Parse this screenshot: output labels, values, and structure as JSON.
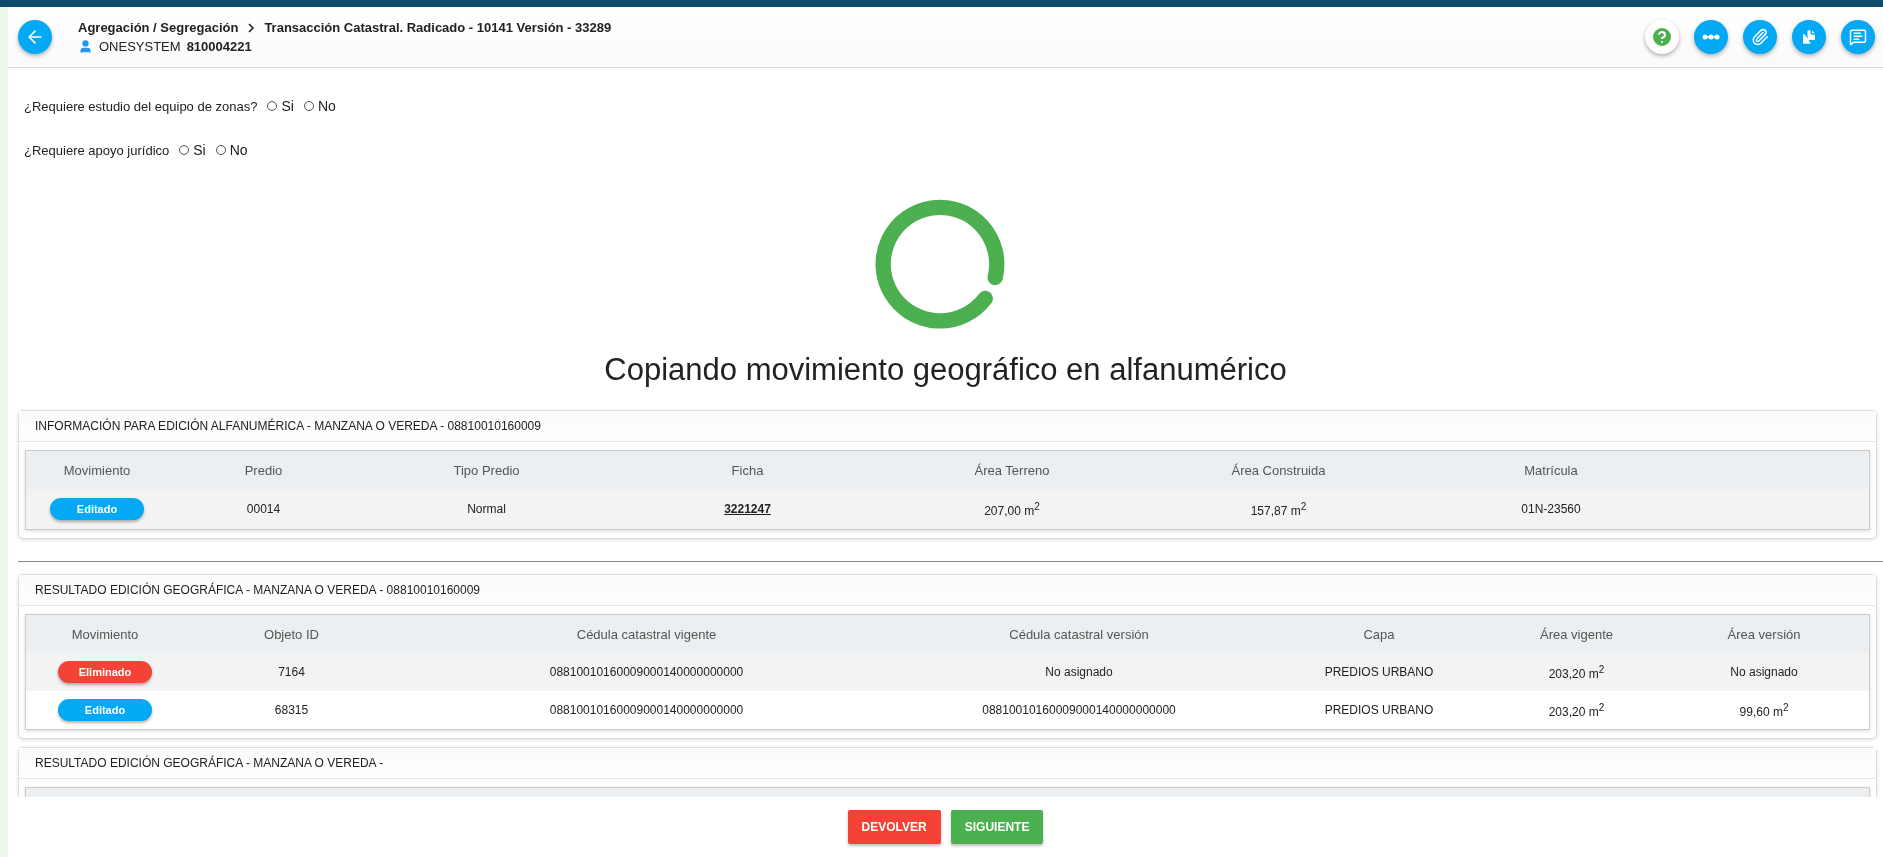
{
  "header": {
    "breadcrumb": [
      "Agregación / Segregación",
      "Transacción Catastral. Radicado - 10141 Versión - 33289"
    ],
    "user": {
      "name": "ONESYSTEM",
      "id": "810004221"
    }
  },
  "questions": [
    {
      "label": "¿Requiere estudio del equipo de zonas?",
      "options": [
        {
          "label": "Si",
          "selected": false
        },
        {
          "label": "No",
          "selected": false
        }
      ]
    },
    {
      "label": "¿Requiere apoyo jurídico",
      "options": [
        {
          "label": "Si",
          "selected": false
        },
        {
          "label": "No",
          "selected": false
        }
      ]
    }
  ],
  "loading": {
    "message": "Copiando movimiento geográfico en alfanumérico"
  },
  "alfanumeric": {
    "title": "INFORMACIÓN PARA EDICIÓN ALFANUMÉRICA - MANZANA O VEREDA - 08810010160009",
    "columns": [
      "Movimiento",
      "Predio",
      "Tipo Predio",
      "Ficha",
      "Área Terreno",
      "Área Construida",
      "Matrícula"
    ],
    "rows": [
      {
        "movimiento": {
          "label": "Editado",
          "color": "#03a9f4"
        },
        "predio": "00014",
        "tipo_predio": "Normal",
        "ficha": "3221247",
        "area_terreno": "207,00 m$^{2}$",
        "area_construida": "157,87 m$^{2}$",
        "matricula": "01N-23560"
      }
    ]
  },
  "geographic": [
    {
      "title": "RESULTADO EDICIÓN GEOGRÁFICA - MANZANA O VEREDA - 08810010160009",
      "columns": [
        "Movimiento",
        "Objeto ID",
        "Cédula catastral vigente",
        "Cédula catastral versión",
        "Capa",
        "Área vigente",
        "Área versión"
      ],
      "rows": [
        {
          "movimiento": {
            "label": "Eliminado",
            "color": "#f44336"
          },
          "objeto_id": "7164",
          "cedula_vigente": "08810010160009000140000000000",
          "cedula_version": "No asignado",
          "capa": "PREDIOS URBANO",
          "area_vigente": "203,20 m$^{2}$",
          "area_version": "No asignado"
        },
        {
          "movimiento": {
            "label": "Editado",
            "color": "#03a9f4"
          },
          "objeto_id": "68315",
          "cedula_vigente": "08810010160009000140000000000",
          "cedula_version": "08810010160009000140000000000",
          "capa": "PREDIOS URBANO",
          "area_vigente": "203,20 m$^{2}$",
          "area_version": "99,60 m$^{2}$"
        }
      ]
    },
    {
      "title": "RESULTADO EDICIÓN GEOGRÁFICA - MANZANA O VEREDA -"
    }
  ],
  "footer": {
    "buttons": [
      {
        "label": "DEVOLVER",
        "kind": "danger"
      },
      {
        "label": "SIGUIENTE",
        "kind": "success"
      }
    ]
  }
}
